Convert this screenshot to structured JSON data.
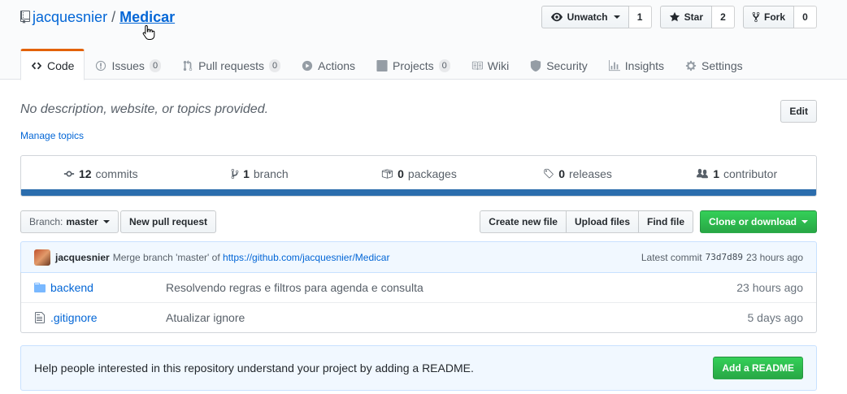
{
  "repo": {
    "owner": "jacquesnier",
    "separator": "/",
    "name": "Medicar"
  },
  "actions": {
    "watch": {
      "label": "Unwatch",
      "count": "1"
    },
    "star": {
      "label": "Star",
      "count": "2"
    },
    "fork": {
      "label": "Fork",
      "count": "0"
    }
  },
  "tabs": [
    {
      "label": "Code",
      "icon": "code-icon",
      "selected": true
    },
    {
      "label": "Issues",
      "icon": "issue-icon",
      "counter": "0"
    },
    {
      "label": "Pull requests",
      "icon": "pull-request-icon",
      "counter": "0"
    },
    {
      "label": "Actions",
      "icon": "play-icon"
    },
    {
      "label": "Projects",
      "icon": "project-icon",
      "counter": "0"
    },
    {
      "label": "Wiki",
      "icon": "book-icon"
    },
    {
      "label": "Security",
      "icon": "shield-icon"
    },
    {
      "label": "Insights",
      "icon": "graph-icon"
    },
    {
      "label": "Settings",
      "icon": "gear-icon"
    }
  ],
  "description": {
    "text": "No description, website, or topics provided.",
    "edit_label": "Edit",
    "topics_link": "Manage topics"
  },
  "summary": {
    "commits": {
      "num": "12",
      "label": "commits"
    },
    "branch": {
      "num": "1",
      "label": "branch"
    },
    "packages": {
      "num": "0",
      "label": "packages"
    },
    "releases": {
      "num": "0",
      "label": "releases"
    },
    "contributor": {
      "num": "1",
      "label": "contributor"
    }
  },
  "nav": {
    "branch_prefix": "Branch:",
    "branch_name": "master",
    "new_pr": "New pull request",
    "create_file": "Create new file",
    "upload_files": "Upload files",
    "find_file": "Find file",
    "clone": "Clone or download"
  },
  "latest_commit": {
    "author": "jacquesnier",
    "message": "Merge branch 'master' of",
    "link": "https://github.com/jacquesnier/Medicar",
    "label": "Latest commit",
    "sha": "73d7d89",
    "age": "23 hours ago"
  },
  "files": [
    {
      "type": "folder",
      "name": "backend",
      "message": "Resolvendo regras e filtros para agenda e consulta",
      "age": "23 hours ago"
    },
    {
      "type": "file",
      "name": ".gitignore",
      "message": "Atualizar ignore",
      "age": "5 days ago"
    }
  ],
  "readme_prompt": {
    "text": "Help people interested in this repository understand your project by adding a README.",
    "button": "Add a README"
  }
}
